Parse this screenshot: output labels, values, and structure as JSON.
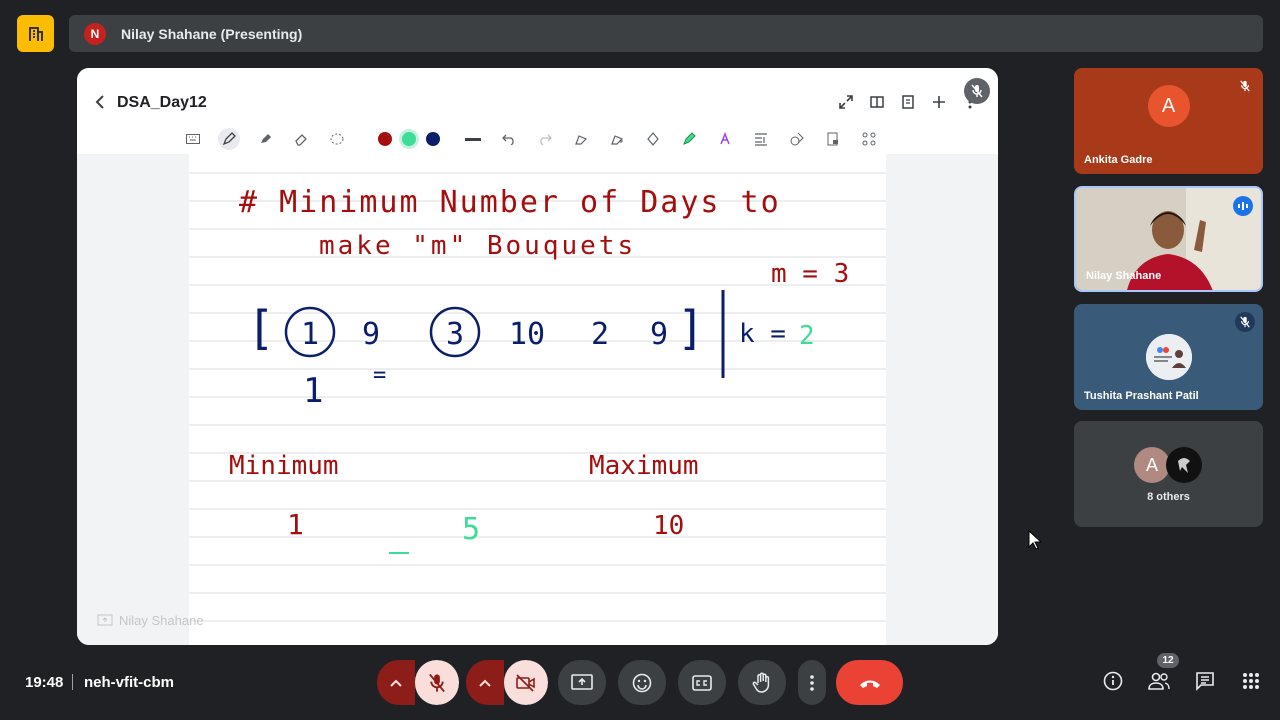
{
  "presenter": {
    "initial": "N",
    "label": "Nilay Shahane (Presenting)"
  },
  "document": {
    "title": "DSA_Day12",
    "self_view_label": "Nilay Shahane",
    "pen_colors": [
      "#a50e0e",
      "#3ddc97",
      "#0b1e6b"
    ]
  },
  "notes": {
    "heading_line1": "# Minimum Number of Days to",
    "heading_line2": "make \"m\" Bouquets",
    "array_open": "[",
    "array": [
      "1",
      "9",
      "3",
      "10",
      "2",
      "9"
    ],
    "array_close": "]",
    "k_label": "k =",
    "k_value": "2",
    "m_label": "m = 3",
    "min_label": "Minimum",
    "max_label": "Maximum",
    "min_value": "1",
    "mid_value": "5",
    "max_value": "10",
    "small_mark": "1",
    "under_mark": "="
  },
  "participants": [
    {
      "name": "Ankita Gadre",
      "initial": "A",
      "muted": true,
      "bg": "#a83a1a"
    },
    {
      "name": "Nilay Shahane",
      "speaking": true
    },
    {
      "name": "Tushita Prashant Patil",
      "muted": true,
      "bg": "#3a5a7a"
    },
    {
      "label": "8 others",
      "initial": "A"
    }
  ],
  "meeting": {
    "time": "19:48",
    "code": "neh-vfit-cbm",
    "participant_count": "12"
  },
  "colors": {
    "accent_yellow": "#fbbc04",
    "hangup_red": "#ea4335",
    "muted_red": "#8c1d18"
  }
}
